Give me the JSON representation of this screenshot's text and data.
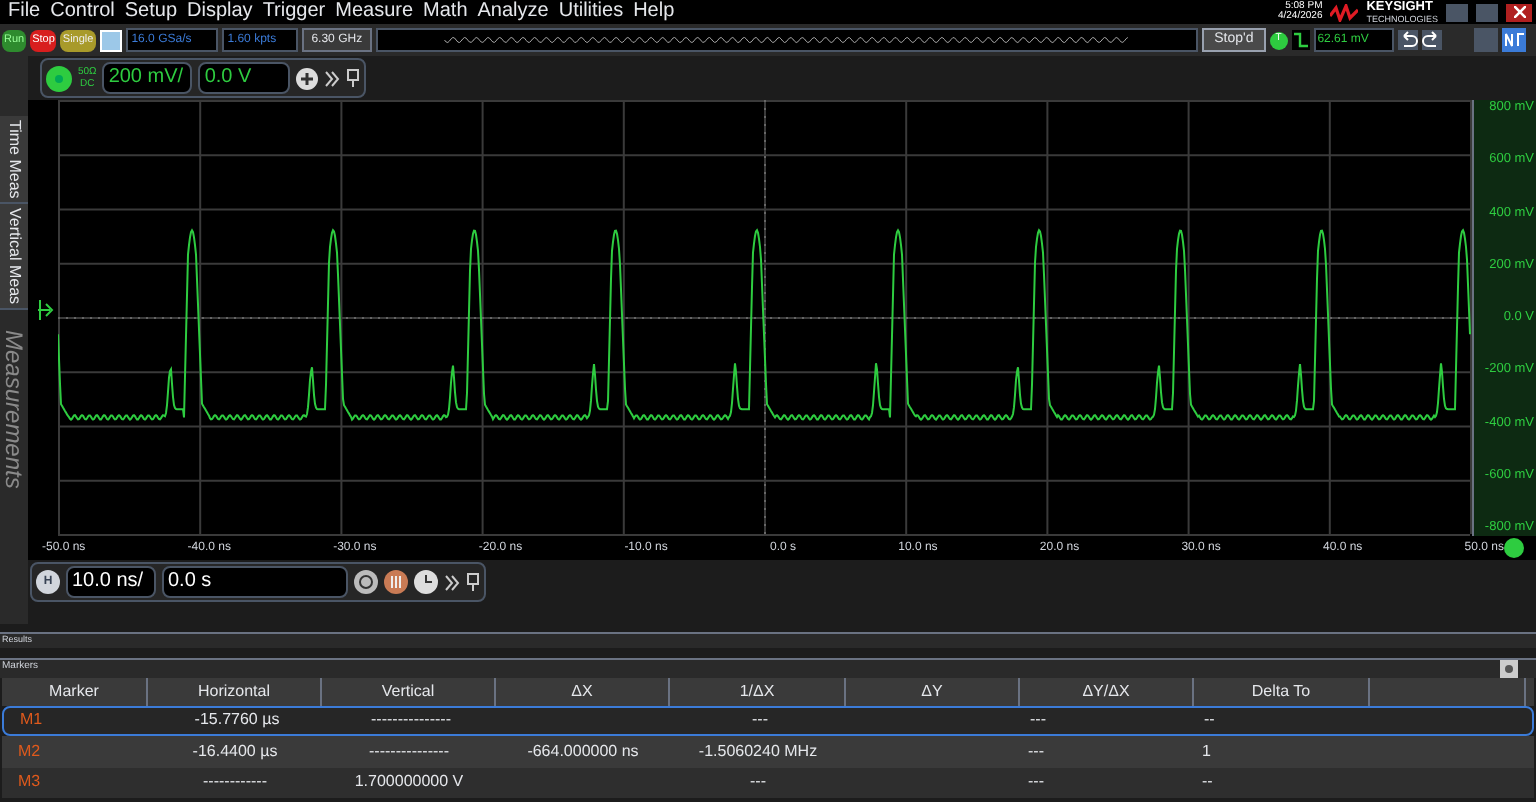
{
  "menu": [
    "File",
    "Control",
    "Setup",
    "Display",
    "Trigger",
    "Measure",
    "Math",
    "Analyze",
    "Utilities",
    "Help"
  ],
  "toolbar": {
    "buttons": [
      {
        "kind": "run",
        "label": "Run"
      },
      {
        "kind": "stop",
        "label": "Stop"
      },
      {
        "kind": "single",
        "label": "Single"
      }
    ],
    "sample_rate": "16.0 GSa/s",
    "memory_depth": "1.60 kpts",
    "bandwidth": "6.30 GHz",
    "acquisition_status": "Stop'd",
    "trigger_badge": "T",
    "trigger_level": "62.61 mV"
  },
  "clock": {
    "time": "5:08 PM",
    "date": "4/24/2026"
  },
  "logo": {
    "name": "KEYSIGHT",
    "tagline": "TECHNOLOGIES"
  },
  "channel": {
    "impedance": "50Ω",
    "coupling": "DC",
    "scale": "200 mV/",
    "offset": "0.0 V"
  },
  "side_tabs": [
    "Time Meas",
    "Vertical Meas",
    "Measurements"
  ],
  "y_axis_labels": [
    "800 mV",
    "600 mV",
    "400 mV",
    "200 mV",
    "0.0 V",
    "-200 mV",
    "-400 mV",
    "-600 mV",
    "-800 mV"
  ],
  "x_axis_labels": [
    "-50.0 ns",
    "-40.0 ns",
    "-30.0 ns",
    "-20.0 ns",
    "-10.0 ns",
    "0.0 s",
    "10.0 ns",
    "20.0 ns",
    "30.0 ns",
    "40.0 ns",
    "50.0 ns"
  ],
  "horizontal": {
    "badge": "H",
    "scale": "10.0 ns/",
    "position": "0.0 s"
  },
  "results": {
    "title": "Results"
  },
  "markers": {
    "title": "Markers",
    "columns": [
      "Marker",
      "Horizontal",
      "Vertical",
      "ΔX",
      "1/ΔX",
      "ΔY",
      "ΔY/ΔX",
      "Delta To"
    ],
    "rows": [
      {
        "selected": true,
        "cells": [
          "M1",
          "-15.7760 µs",
          "---------------",
          "",
          "---",
          "",
          "---",
          "--"
        ]
      },
      {
        "selected": false,
        "cells": [
          "M2",
          "-16.4400 µs",
          "---------------",
          "-664.000000 ns",
          "-1.5060240 MHz",
          "",
          "---",
          "1"
        ]
      },
      {
        "selected": false,
        "cells": [
          "M3",
          "------------",
          "1.700000000 V",
          "",
          "---",
          "",
          "---",
          "--"
        ]
      }
    ]
  }
}
